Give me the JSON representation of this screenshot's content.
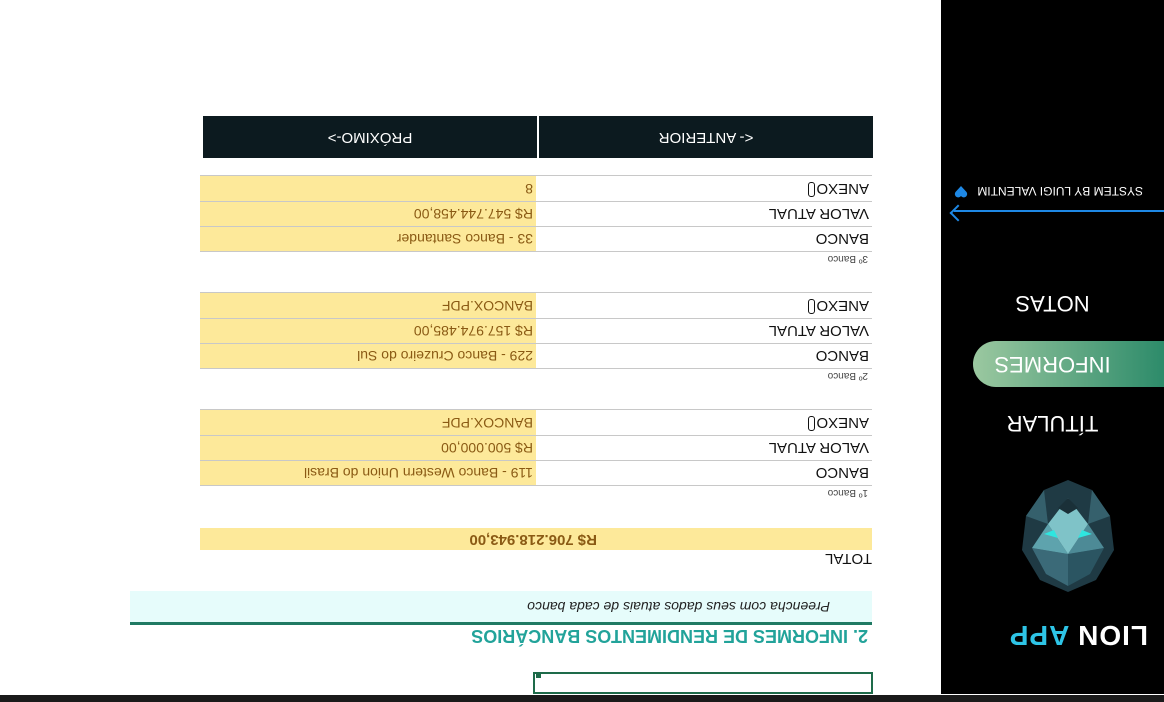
{
  "app": {
    "logo_word1": "LION",
    "logo_word2": "APP"
  },
  "sidebar": {
    "items": [
      {
        "label": "TÍTULAR"
      },
      {
        "label": "INFORMES"
      },
      {
        "label": "NOTAS"
      }
    ],
    "active_index": 1,
    "credit": "SYSTEM BY LUIGI VALENTIM"
  },
  "form": {
    "section_title": "2. INFORMES DE RENDIMENTOS BANCÁRIOS",
    "hint": "Preencha com seus dados atuais de cada banco",
    "total_label": "TOTAL",
    "total_value": "R$ 706.218.943,00",
    "banks": [
      {
        "caption": "1º Banco",
        "bank_label": "BANCO",
        "bank": "119 - Banco Western Union do Brasil",
        "value_label": "VALOR ATUAL",
        "value": "R$ 500.000,00",
        "attach_label": "ANEXO",
        "attach": "BANCOX.PDF"
      },
      {
        "caption": "2º Banco",
        "bank_label": "BANCO",
        "bank": "229 - Banco Cruzeiro do Sul",
        "value_label": "VALOR ATUAL",
        "value": "R$ 157.974.485,00",
        "attach_label": "ANEXO",
        "attach": "BANCOX.PDF"
      },
      {
        "caption": "3º Banco",
        "bank_label": "BANCO",
        "bank": "33 - Banco Santander",
        "value_label": "VALOR ATUAL",
        "value": "R$ 547.744.458,00",
        "attach_label": "ANEXO",
        "attach": "8"
      }
    ],
    "prev_label": "<- ANTERIOR",
    "next_label": "PRÓXIMO->"
  },
  "colors": {
    "accent": "#22a39a",
    "sidebar_bg": "#000000",
    "field_bg": "#fde99a",
    "button_bg": "#0c1a1f"
  }
}
